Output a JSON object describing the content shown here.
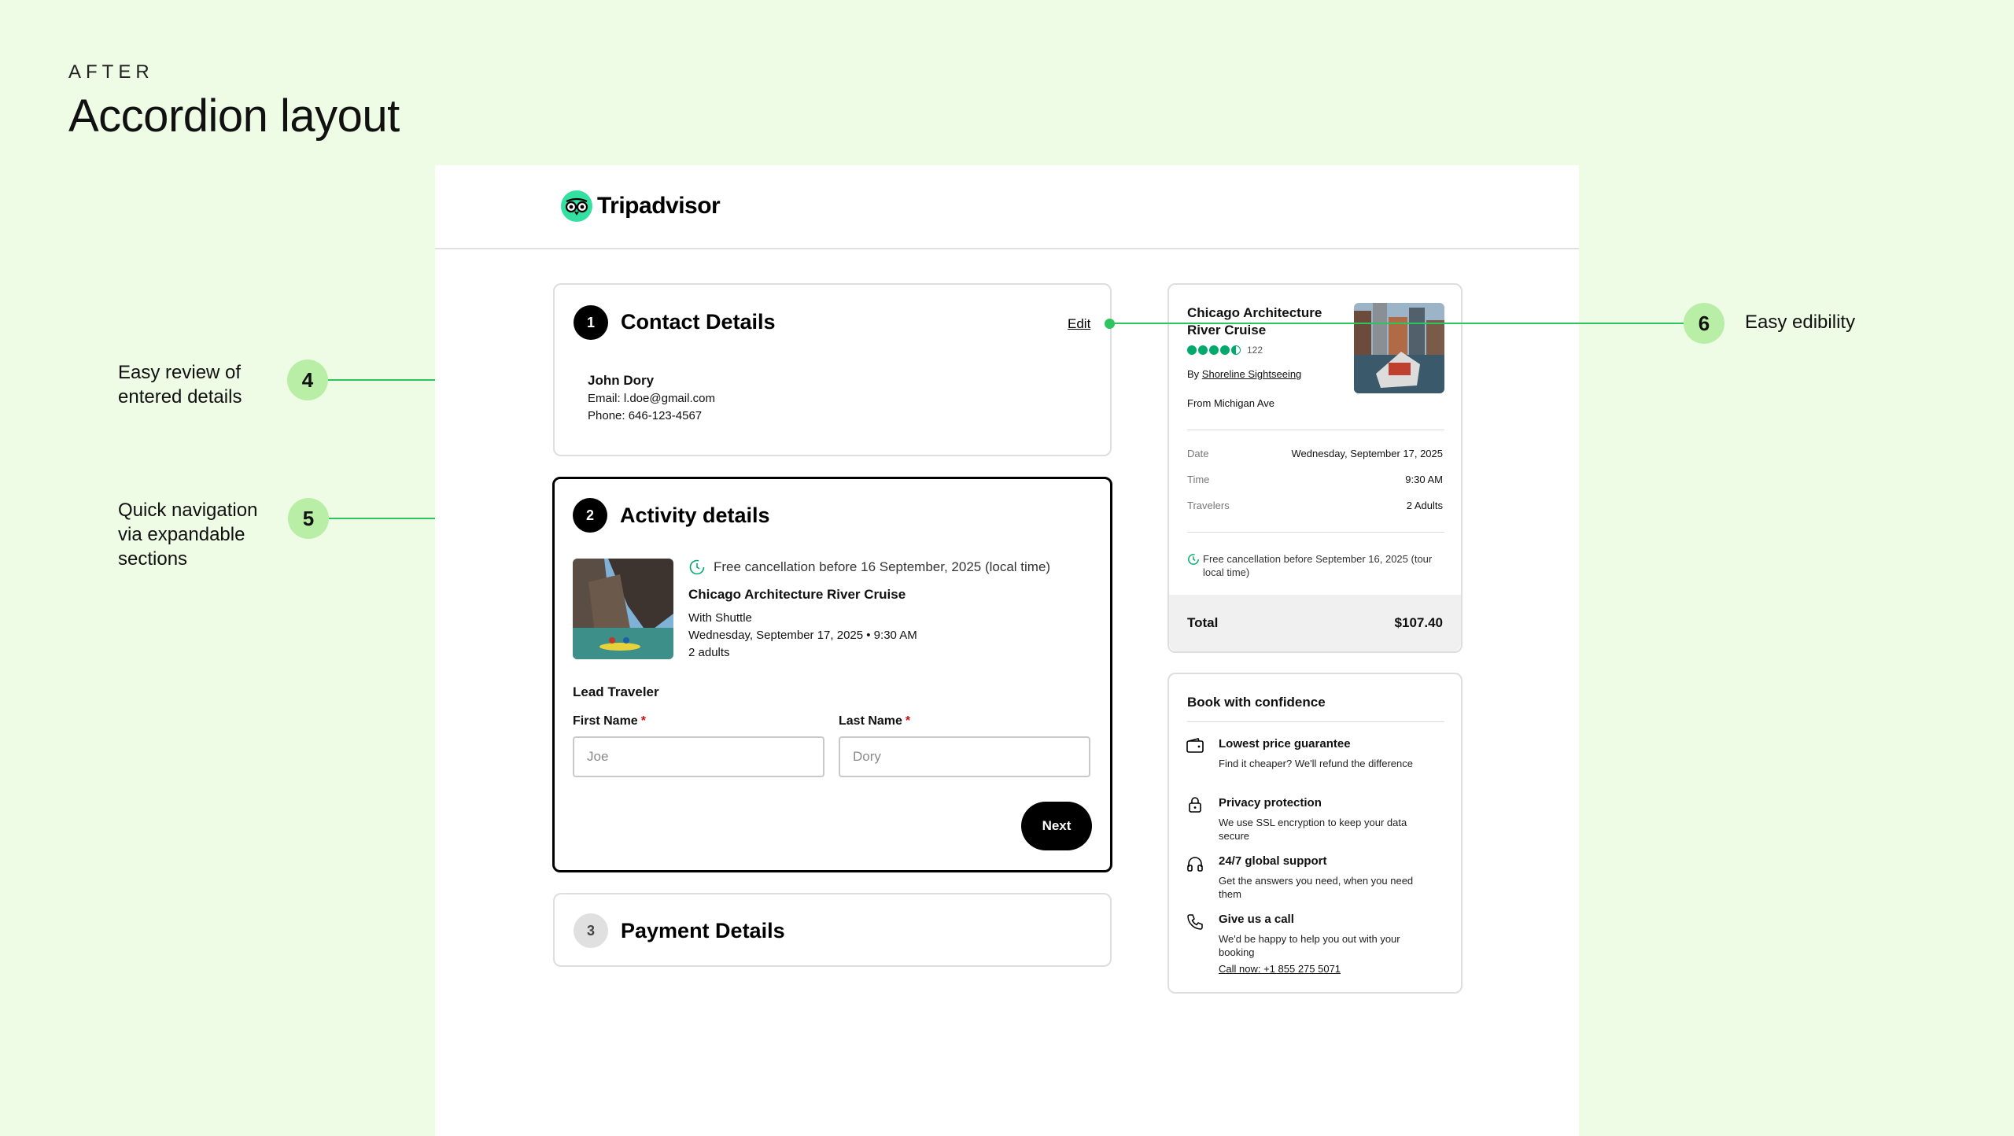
{
  "slide": {
    "eyebrow": "AFTER",
    "headline": "Accordion layout"
  },
  "brand": {
    "name": "Tripadvisor",
    "accent": "#34e0a1"
  },
  "contact": {
    "step": "1",
    "title": "Contact Details",
    "edit_label": "Edit",
    "name": "John Dory",
    "email": "Email: l.doe@gmail.com",
    "phone": "Phone: 646-123-4567"
  },
  "activity": {
    "step": "2",
    "title": "Activity details",
    "cancellation": "Free cancellation before 16 September, 2025 (local time)",
    "product_title": "Chicago Architecture River Cruise",
    "option": "With Shuttle",
    "datetime": "Wednesday, September 17, 2025 • 9:30 AM",
    "guests": "2 adults",
    "lead_traveler_label": "Lead Traveler",
    "first_name_label": "First Name",
    "last_name_label": "Last Name",
    "required_mark": "*",
    "first_name_placeholder": "Joe",
    "last_name_placeholder": "Dory",
    "next_label": "Next"
  },
  "payment": {
    "step": "3",
    "title": "Payment Details"
  },
  "summary": {
    "title": "Chicago Architecture River Cruise",
    "rating": 4.5,
    "review_count": "122",
    "by_prefix": "By",
    "operator": "Shoreline Sightseeing",
    "from": "From Michigan Ave",
    "rows": [
      {
        "key": "Date",
        "value": "Wednesday, September 17, 2025"
      },
      {
        "key": "Time",
        "value": "9:30 AM"
      },
      {
        "key": "Travelers",
        "value": "2 Adults"
      }
    ],
    "cancellation": "Free cancellation before September 16, 2025 (tour local time)",
    "total_label": "Total",
    "total_value": "$107.40"
  },
  "confidence": {
    "title": "Book with confidence",
    "items": [
      {
        "icon": "wallet-icon",
        "title": "Lowest price guarantee",
        "desc": "Find it cheaper? We'll refund the difference"
      },
      {
        "icon": "lock-icon",
        "title": "Privacy protection",
        "desc": "We use SSL encryption to keep your data secure"
      },
      {
        "icon": "headphones-icon",
        "title": "24/7 global support",
        "desc": "Get the answers you need, when you need them"
      },
      {
        "icon": "phone-icon",
        "title": "Give us a call",
        "desc": "We'd be happy to help you out with your booking"
      }
    ],
    "call_link": "Call now: +1 855 275 5071"
  },
  "annotations": [
    {
      "number": "4",
      "text": "Easy review of entered details"
    },
    {
      "number": "5",
      "text": "Quick navigation via expandable sections"
    },
    {
      "number": "6",
      "text": "Easy edibility"
    }
  ],
  "colors": {
    "background": "#eefbe5",
    "annotation_badge": "#b8eea6",
    "connector": "#2dc55e",
    "rating": "#00aa6c"
  }
}
